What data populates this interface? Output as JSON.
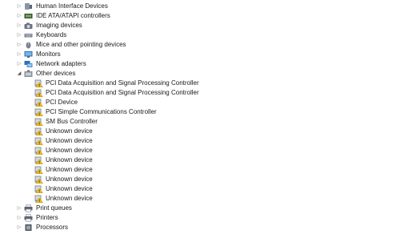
{
  "tree": [
    {
      "label": "Human Interface Devices",
      "icon": "hid-icon",
      "state": "collapsed",
      "level": 0
    },
    {
      "label": "IDE ATA/ATAPI controllers",
      "icon": "ide-controller-icon",
      "state": "collapsed",
      "level": 0
    },
    {
      "label": "Imaging devices",
      "icon": "camera-icon",
      "state": "collapsed",
      "level": 0
    },
    {
      "label": "Keyboards",
      "icon": "keyboard-icon",
      "state": "collapsed",
      "level": 0
    },
    {
      "label": "Mice and other pointing devices",
      "icon": "mouse-icon",
      "state": "collapsed",
      "level": 0
    },
    {
      "label": "Monitors",
      "icon": "monitor-icon",
      "state": "collapsed",
      "level": 0
    },
    {
      "label": "Network adapters",
      "icon": "network-adapter-icon",
      "state": "collapsed",
      "level": 0
    },
    {
      "label": "Other devices",
      "icon": "other-devices-icon",
      "state": "expanded",
      "level": 0
    },
    {
      "label": "PCI Data Acquisition and Signal Processing Controller",
      "icon": "unknown-device-warning-icon",
      "level": 1
    },
    {
      "label": "PCI Data Acquisition and Signal Processing Controller",
      "icon": "unknown-device-warning-icon",
      "level": 1
    },
    {
      "label": "PCI Device",
      "icon": "unknown-device-warning-icon",
      "level": 1
    },
    {
      "label": "PCI Simple Communications Controller",
      "icon": "unknown-device-warning-icon",
      "level": 1
    },
    {
      "label": "SM Bus Controller",
      "icon": "unknown-device-warning-icon",
      "level": 1
    },
    {
      "label": "Unknown device",
      "icon": "unknown-device-warning-icon",
      "level": 1
    },
    {
      "label": "Unknown device",
      "icon": "unknown-device-warning-icon",
      "level": 1
    },
    {
      "label": "Unknown device",
      "icon": "unknown-device-warning-icon",
      "level": 1
    },
    {
      "label": "Unknown device",
      "icon": "unknown-device-warning-icon",
      "level": 1
    },
    {
      "label": "Unknown device",
      "icon": "unknown-device-warning-icon",
      "level": 1
    },
    {
      "label": "Unknown device",
      "icon": "unknown-device-warning-icon",
      "level": 1
    },
    {
      "label": "Unknown device",
      "icon": "unknown-device-warning-icon",
      "level": 1
    },
    {
      "label": "Unknown device",
      "icon": "unknown-device-warning-icon",
      "level": 1
    },
    {
      "label": "Print queues",
      "icon": "printer-icon",
      "state": "collapsed",
      "level": 0
    },
    {
      "label": "Printers",
      "icon": "printer-icon",
      "state": "collapsed",
      "level": 0
    },
    {
      "label": "Processors",
      "icon": "processor-icon",
      "state": "collapsed",
      "level": 0
    }
  ],
  "colors": {
    "warning_yellow": "#f5c518",
    "device_gray": "#6b7280",
    "monitor_blue": "#2f6fb5"
  }
}
